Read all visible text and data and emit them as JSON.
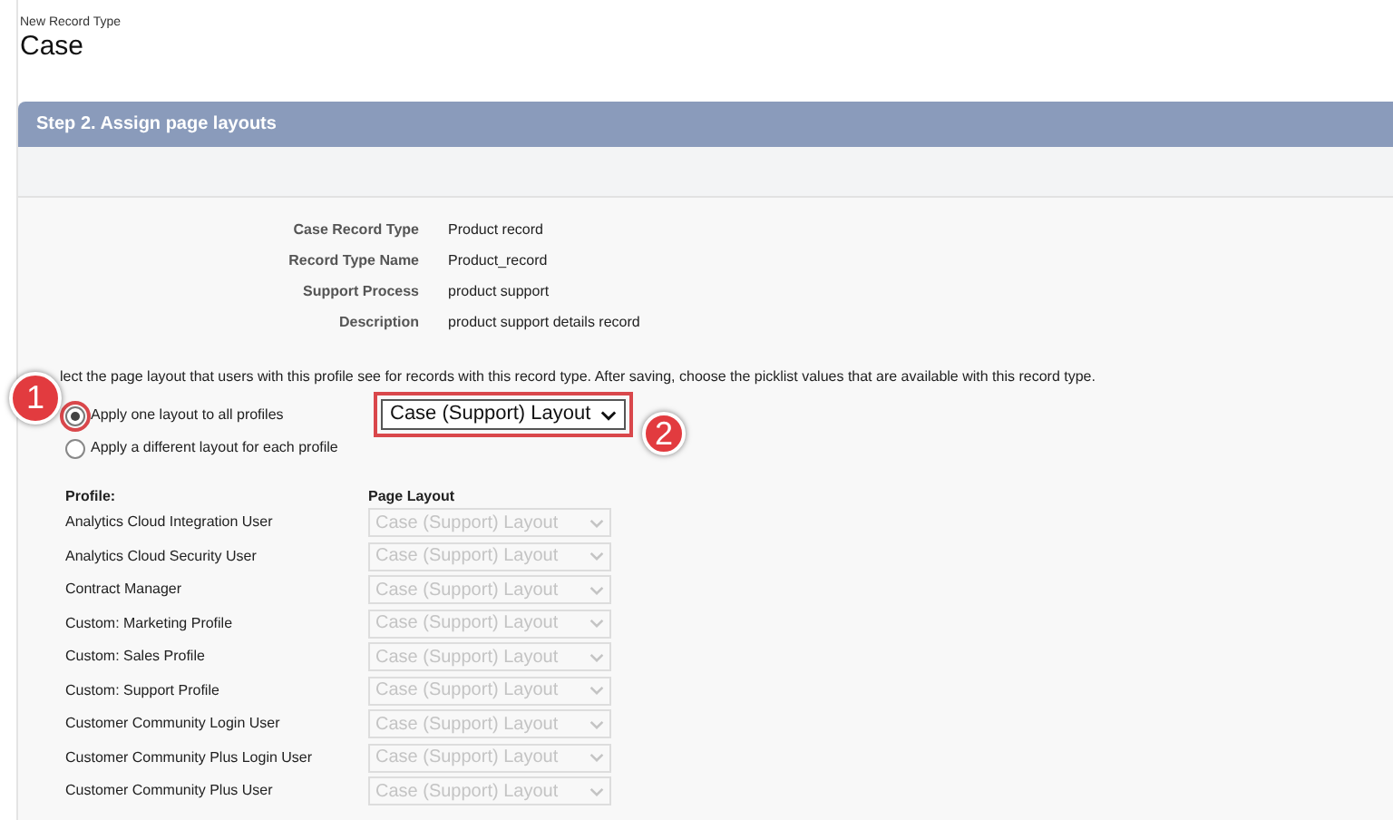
{
  "header": {
    "subtitle": "New Record Type",
    "title": "Case"
  },
  "section": {
    "title": "Step 2. Assign page layouts"
  },
  "details": [
    {
      "label": "Case Record Type",
      "value": "Product record"
    },
    {
      "label": "Record Type Name",
      "value": "Product_record"
    },
    {
      "label": "Support Process",
      "value": "product support"
    },
    {
      "label": "Description",
      "value": "product support details record"
    }
  ],
  "instruction": "lect the page layout that users with this profile see for records with this record type. After saving, choose the picklist values that are available with this record type.",
  "callouts": [
    "1",
    "2"
  ],
  "options": [
    {
      "label": "Apply one layout to all profiles",
      "selected": true
    },
    {
      "label": "Apply a different layout for each profile",
      "selected": false
    }
  ],
  "layout_select": {
    "value": "Case (Support) Layout"
  },
  "table": {
    "columns": [
      "Profile:",
      "Page Layout"
    ],
    "rows": [
      {
        "profile": "Analytics Cloud Integration User",
        "layout": "Case (Support) Layout",
        "disabled": true
      },
      {
        "profile": "Analytics Cloud Security User",
        "layout": "Case (Support) Layout",
        "disabled": true
      },
      {
        "profile": "Contract Manager",
        "layout": "Case (Support) Layout",
        "disabled": true
      },
      {
        "profile": "Custom: Marketing Profile",
        "layout": "Case (Support) Layout",
        "disabled": true
      },
      {
        "profile": "Custom: Sales Profile",
        "layout": "Case (Support) Layout",
        "disabled": true
      },
      {
        "profile": "Custom: Support Profile",
        "layout": "Case (Support) Layout",
        "disabled": true
      },
      {
        "profile": "Customer Community Login User",
        "layout": "Case (Support) Layout",
        "disabled": true
      },
      {
        "profile": "Customer Community Plus Login User",
        "layout": "Case (Support) Layout",
        "disabled": true
      },
      {
        "profile": "Customer Community Plus User",
        "layout": "Case (Support) Layout",
        "disabled": true
      }
    ]
  }
}
